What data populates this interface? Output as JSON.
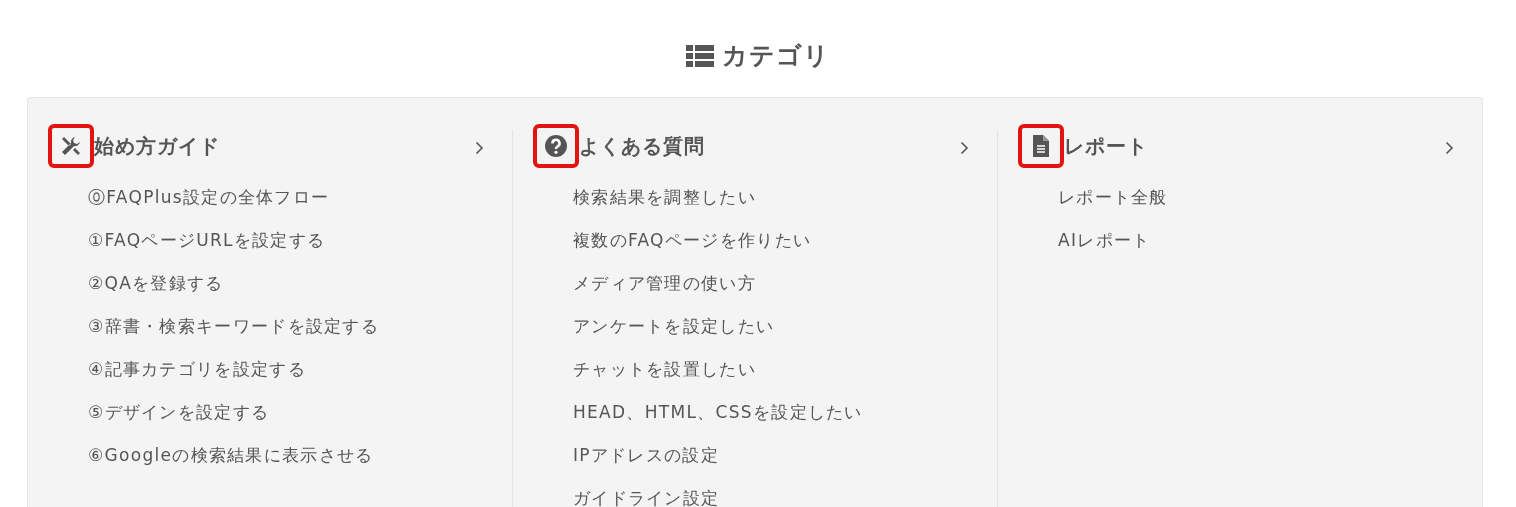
{
  "heading": {
    "title": "カテゴリ"
  },
  "categories": [
    {
      "kind": "tools",
      "title": "始め方ガイド",
      "highlighted": true,
      "items": [
        "⓪FAQPlus設定の全体フロー",
        "①FAQページURLを設定する",
        "②QAを登録する",
        "③辞書・検索キーワードを設定する",
        "④記事カテゴリを設定する",
        "⑤デザインを設定する",
        "⑥Googleの検索結果に表示させる"
      ]
    },
    {
      "kind": "question",
      "title": "よくある質問",
      "highlighted": true,
      "items": [
        "検索結果を調整したい",
        "複数のFAQページを作りたい",
        "メディア管理の使い方",
        "アンケートを設定したい",
        "チャットを設置したい",
        "HEAD、HTML、CSSを設定したい",
        "IPアドレスの設定",
        "ガイドライン設定"
      ]
    },
    {
      "kind": "document",
      "title": "レポート",
      "highlighted": true,
      "items": [
        "レポート全般",
        "AIレポート"
      ]
    }
  ]
}
